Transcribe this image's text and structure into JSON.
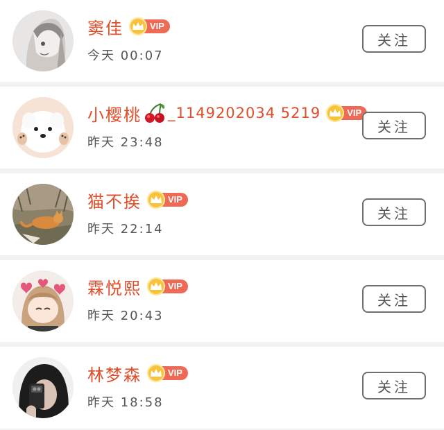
{
  "follow_list": {
    "users": [
      {
        "name": "窦佳",
        "vip_label": "VIP",
        "time": "今天 00:07",
        "follow_label": "关注",
        "avatar": "anime-girl-sketch"
      },
      {
        "name_prefix": "小樱桃",
        "name_emoji": "cherry",
        "name_suffix": "_1149202034 5219",
        "vip_label": "VIP",
        "time": "昨天 23:48",
        "follow_label": "关注",
        "avatar": "white-puppy"
      },
      {
        "name": "猫不挨",
        "vip_label": "VIP",
        "time": "昨天 22:14",
        "follow_label": "关注",
        "avatar": "cat-in-grass"
      },
      {
        "name": "霖悦熙",
        "vip_label": "VIP",
        "time": "昨天 20:43",
        "follow_label": "关注",
        "avatar": "anime-girl-hearts"
      },
      {
        "name": "林梦森",
        "vip_label": "VIP",
        "time": "昨天 18:58",
        "follow_label": "关注",
        "avatar": "mirror-selfie"
      }
    ]
  },
  "colors": {
    "name": "#e04e2a",
    "vip_badge": "#ee6a57",
    "vip_crown": "#f7c23c",
    "background": "#f2f2f2"
  }
}
